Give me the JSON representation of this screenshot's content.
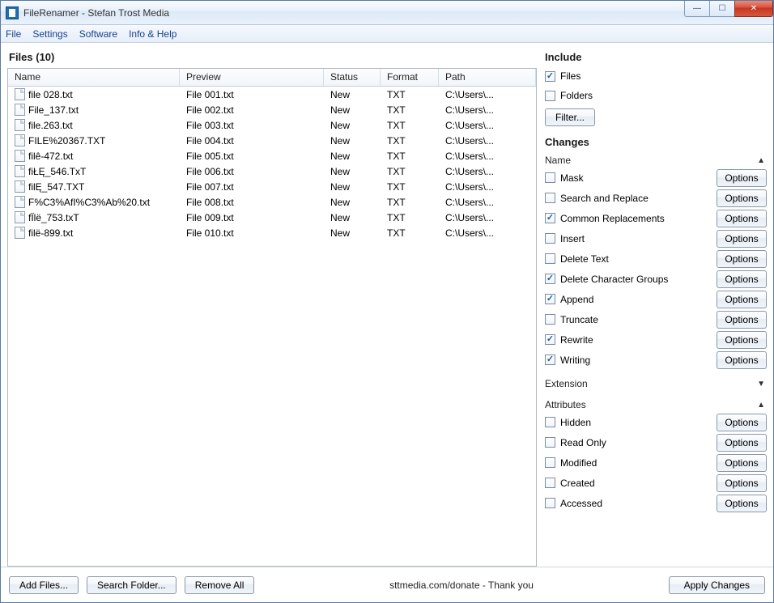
{
  "window": {
    "title": "FileRenamer - Stefan Trost Media"
  },
  "menu": {
    "file": "File",
    "settings": "Settings",
    "software": "Software",
    "info": "Info & Help"
  },
  "files": {
    "header": "Files (10)",
    "columns": {
      "name": "Name",
      "preview": "Preview",
      "status": "Status",
      "format": "Format",
      "path": "Path"
    },
    "rows": [
      {
        "name": "file 028.txt",
        "preview": "File 001.txt",
        "status": "New",
        "format": "TXT",
        "path": "C:\\Users\\..."
      },
      {
        "name": "File_137.txt",
        "preview": "File 002.txt",
        "status": "New",
        "format": "TXT",
        "path": "C:\\Users\\..."
      },
      {
        "name": "file.263.txt",
        "preview": "File 003.txt",
        "status": "New",
        "format": "TXT",
        "path": "C:\\Users\\..."
      },
      {
        "name": "FILE%20367.TXT",
        "preview": "File 004.txt",
        "status": "New",
        "format": "TXT",
        "path": "C:\\Users\\..."
      },
      {
        "name": "filê-472.txt",
        "preview": "File 005.txt",
        "status": "New",
        "format": "TXT",
        "path": "C:\\Users\\..."
      },
      {
        "name": "fiŁĘ_546.TxT",
        "preview": "File 006.txt",
        "status": "New",
        "format": "TXT",
        "path": "C:\\Users\\..."
      },
      {
        "name": "filĘ_547.TXT",
        "preview": "File 007.txt",
        "status": "New",
        "format": "TXT",
        "path": "C:\\Users\\..."
      },
      {
        "name": "F%C3%AfI%C3%Ab%20.txt",
        "preview": "File 008.txt",
        "status": "New",
        "format": "TXT",
        "path": "C:\\Users\\..."
      },
      {
        "name": "fÏlë_753.txT",
        "preview": "File 009.txt",
        "status": "New",
        "format": "TXT",
        "path": "C:\\Users\\..."
      },
      {
        "name": "filë-899.txt",
        "preview": "File 010.txt",
        "status": "New",
        "format": "TXT",
        "path": "C:\\Users\\..."
      }
    ]
  },
  "include": {
    "title": "Include",
    "files": {
      "label": "Files",
      "checked": true
    },
    "folders": {
      "label": "Folders",
      "checked": false
    },
    "filter_btn": "Filter..."
  },
  "changes": {
    "title": "Changes",
    "name_section": "Name",
    "extension_section": "Extension",
    "attributes_section": "Attributes",
    "options_label": "Options",
    "name_items": [
      {
        "label": "Mask",
        "checked": false
      },
      {
        "label": "Search and Replace",
        "checked": false
      },
      {
        "label": "Common Replacements",
        "checked": true
      },
      {
        "label": "Insert",
        "checked": false
      },
      {
        "label": "Delete Text",
        "checked": false
      },
      {
        "label": "Delete Character Groups",
        "checked": true
      },
      {
        "label": "Append",
        "checked": true
      },
      {
        "label": "Truncate",
        "checked": false
      },
      {
        "label": "Rewrite",
        "checked": true
      },
      {
        "label": "Writing",
        "checked": true
      }
    ],
    "attr_items": [
      {
        "label": "Hidden",
        "checked": false
      },
      {
        "label": "Read Only",
        "checked": false
      },
      {
        "label": "Modified",
        "checked": false
      },
      {
        "label": "Created",
        "checked": false
      },
      {
        "label": "Accessed",
        "checked": false
      }
    ]
  },
  "bottom": {
    "add_files": "Add Files...",
    "search_folder": "Search Folder...",
    "remove_all": "Remove All",
    "donate": "sttmedia.com/donate - Thank you",
    "apply": "Apply Changes"
  }
}
